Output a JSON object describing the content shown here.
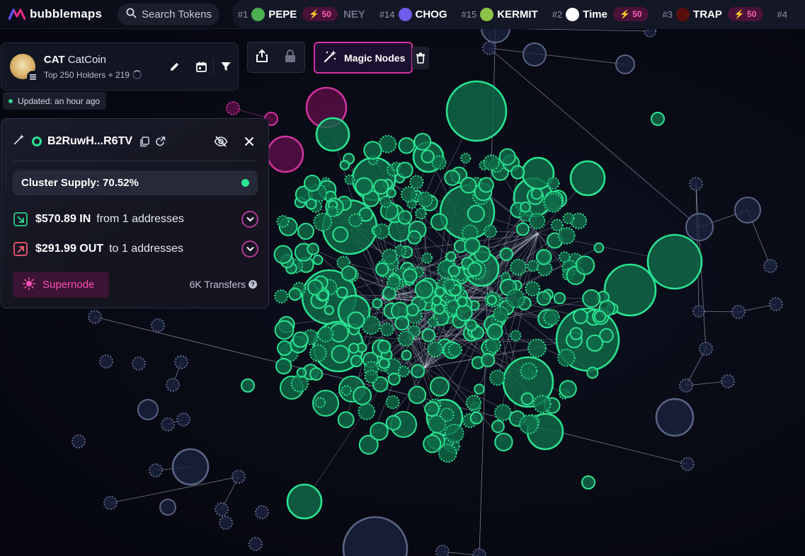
{
  "brand": {
    "name": "bubblemaps"
  },
  "search": {
    "placeholder": "Search Tokens"
  },
  "ticker": [
    {
      "rank": "#1",
      "name": "PEPE",
      "badge": "50",
      "avatar_color": "#4caf50"
    },
    {
      "rank": "",
      "name": "NEY",
      "badge": "",
      "avatar_color": ""
    },
    {
      "rank": "#14",
      "name": "CHOG",
      "badge": "",
      "avatar_color": "#6c5ce7"
    },
    {
      "rank": "#15",
      "name": "KERMIT",
      "badge": "",
      "avatar_color": "#8bc34a"
    },
    {
      "rank": "#2",
      "name": "Time",
      "badge": "50",
      "avatar_color": "#ffffff"
    },
    {
      "rank": "#3",
      "name": "TRAP",
      "badge": "50",
      "avatar_color": "#5a0f0f"
    },
    {
      "rank": "#4",
      "name": "",
      "badge": "",
      "avatar_color": ""
    }
  ],
  "token": {
    "symbol": "CAT",
    "name": "CatCoin",
    "subtitle": "Top 250 Holders + 219",
    "updated": "Updated: an hour ago"
  },
  "toolbar": {
    "magic_nodes_label": "Magic Nodes"
  },
  "cluster": {
    "address": "B2RuwH...R6TV",
    "supply_label": "Cluster Supply: 70.52%",
    "in_amount": "$570.89 IN",
    "in_desc": "from 1 addresses",
    "out_amount": "$291.99 OUT",
    "out_desc": "to 1 addresses",
    "supernode_label": "Supernode",
    "transfers": "6K Transfers"
  },
  "colors": {
    "accent_green": "#2be392",
    "accent_pink": "#d0339d",
    "node_gray": "#5a6484",
    "background": "#080a14"
  }
}
